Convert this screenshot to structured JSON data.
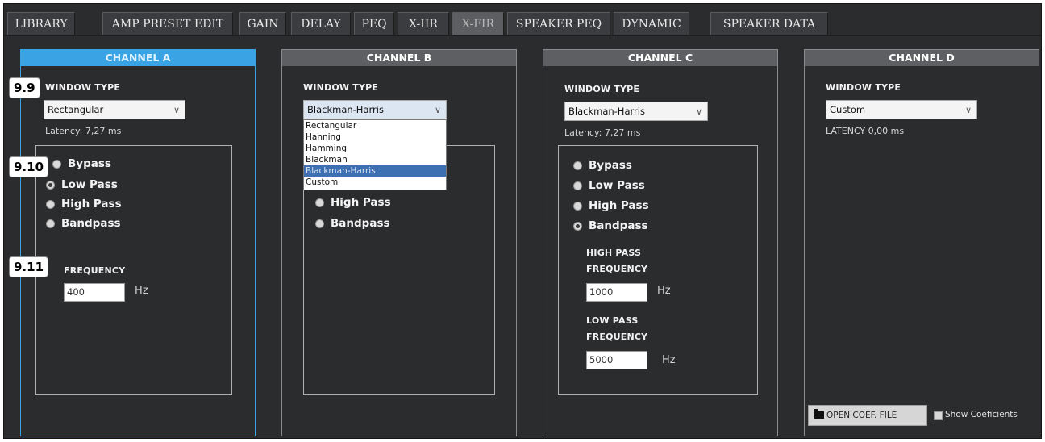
{
  "tabs": [
    {
      "label": "LIBRARY"
    },
    {
      "label": "AMP PRESET EDIT"
    },
    {
      "label": "GAIN"
    },
    {
      "label": "DELAY"
    },
    {
      "label": "PEQ"
    },
    {
      "label": "X-IIR"
    },
    {
      "label": "X-FIR"
    },
    {
      "label": "SPEAKER PEQ"
    },
    {
      "label": "DYNAMIC"
    },
    {
      "label": "SPEAKER DATA"
    }
  ],
  "callouts": [
    "9.9",
    "9.10",
    "9.11"
  ],
  "channels": {
    "a": {
      "title": "CHANNEL A",
      "window_label": "WINDOW TYPE",
      "window_value": "Rectangular",
      "latency": "Latency: 7,27 ms",
      "filters": [
        "Bypass",
        "Low Pass",
        "High Pass",
        "Bandpass"
      ],
      "selected_filter": "Low Pass",
      "freq_label": "FREQUENCY",
      "freq_value": "400",
      "unit": "Hz"
    },
    "b": {
      "title": "CHANNEL B",
      "window_label": "WINDOW TYPE",
      "window_value": "Blackman-Harris",
      "dropdown_options": [
        "Rectangular",
        "Hanning",
        "Hamming",
        "Blackman",
        "Blackman-Harris",
        "Custom"
      ],
      "dropdown_selected": "Blackman-Harris",
      "visible_filters": [
        "High Pass",
        "Bandpass"
      ]
    },
    "c": {
      "title": "CHANNEL C",
      "window_label": "WINDOW TYPE",
      "window_value": "Blackman-Harris",
      "latency": "Latency: 7,27 ms",
      "filters": [
        "Bypass",
        "Low Pass",
        "High Pass",
        "Bandpass"
      ],
      "selected_filter": "Bandpass",
      "hp_label_1": "HIGH PASS",
      "hp_label_2": "FREQUENCY",
      "hp_value": "1000",
      "lp_label_1": "LOW PASS",
      "lp_label_2": "FREQUENCY",
      "lp_value": "5000",
      "unit": "Hz"
    },
    "d": {
      "title": "CHANNEL D",
      "window_label": "WINDOW TYPE",
      "window_value": "Custom",
      "latency": "LATENCY 0,00 ms",
      "open_button": "OPEN COEF. FILE",
      "show_coef": "Show Coeficients"
    }
  },
  "colors": {
    "background": "#2b2c2e",
    "active_header": "#3aa3e3",
    "dropdown_highlight": "#3d6fb3"
  }
}
